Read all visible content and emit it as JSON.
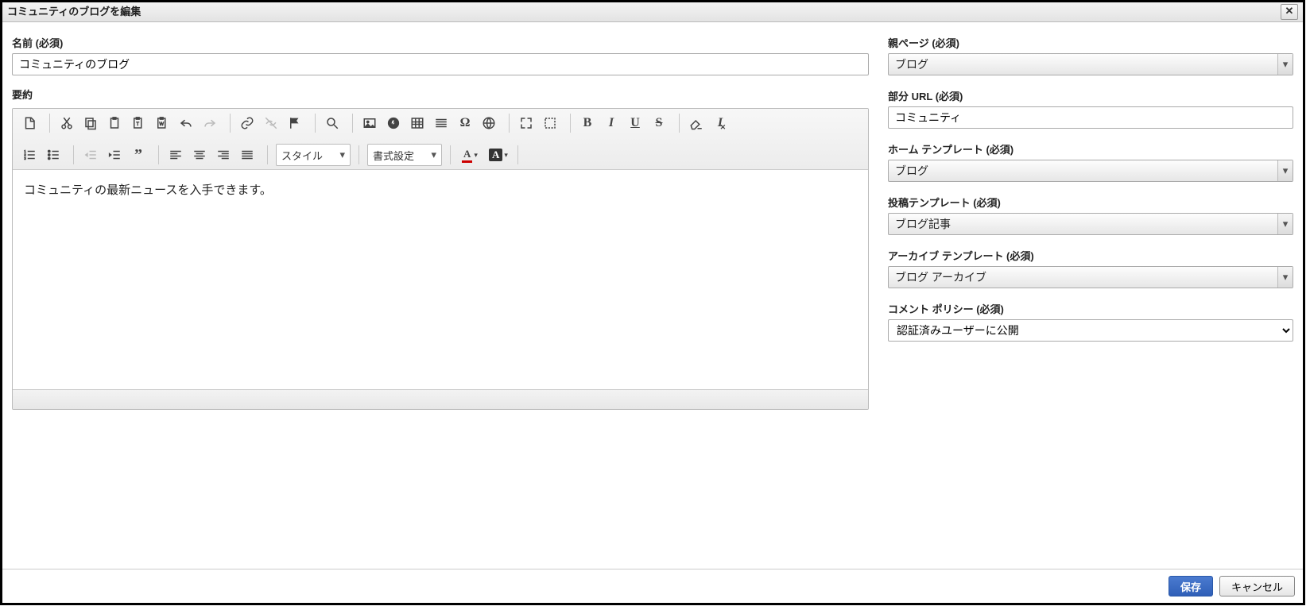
{
  "title": "コミュニティのブログを編集",
  "close_glyph": "✕",
  "left": {
    "name_label": "名前 (必須)",
    "name_value": "コミュニティのブログ",
    "summary_label": "要約",
    "editor_content": "コミュニティの最新ニュースを入手できます。"
  },
  "toolbar": {
    "style_combo": "スタイル",
    "format_combo": "書式設定",
    "textcolor_letter": "A",
    "bgcolor_letter": "A",
    "bold": "B",
    "italic": "I",
    "underline": "U",
    "strike": "S"
  },
  "right": {
    "parent_label": "親ページ (必須)",
    "parent_value": "ブログ",
    "partial_url_label": "部分 URL (必須)",
    "partial_url_value": "コミュニティ",
    "home_tpl_label": "ホーム テンプレート (必須)",
    "home_tpl_value": "ブログ",
    "post_tpl_label": "投稿テンプレート (必須)",
    "post_tpl_value": "ブログ記事",
    "archive_tpl_label": "アーカイブ テンプレート (必須)",
    "archive_tpl_value": "ブログ アーカイブ",
    "comment_policy_label": "コメント ポリシー (必須)",
    "comment_policy_value": "認証済みユーザーに公開"
  },
  "footer": {
    "save": "保存",
    "cancel": "キャンセル"
  }
}
